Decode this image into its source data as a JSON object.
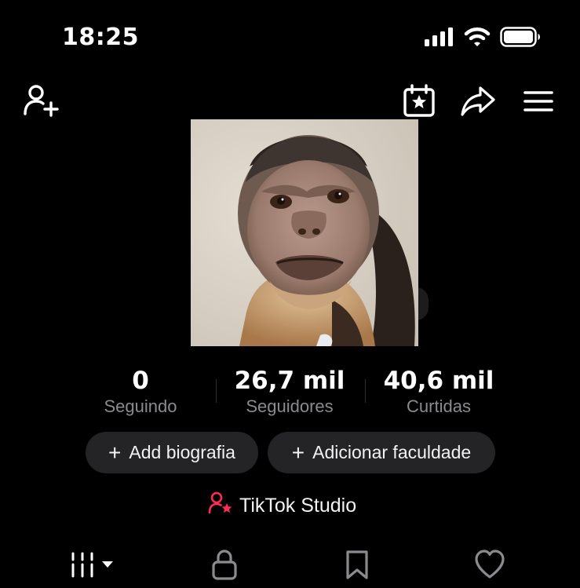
{
  "status_bar": {
    "time": "18:25",
    "icons": [
      "signal-icon",
      "wifi-icon",
      "battery-icon"
    ]
  },
  "header": {
    "left_icons": [
      "add-friend-icon"
    ],
    "right_icons": [
      "calendar-star-icon",
      "share-icon",
      "menu-icon"
    ]
  },
  "profile": {
    "avatar": "capuchin-monkey-photo"
  },
  "stats": [
    {
      "value": "0",
      "label": "Seguindo"
    },
    {
      "value": "26,7 mil",
      "label": "Seguidores"
    },
    {
      "value": "40,6 mil",
      "label": "Curtidas"
    }
  ],
  "actions": {
    "add_bio_label": "Add biografia",
    "add_college_label": "Adicionar faculdade",
    "plus_symbol": "+"
  },
  "studio": {
    "label": "TikTok Studio",
    "accent_color": "#fe2c55"
  },
  "tabs": [
    "grid-icon",
    "lock-icon",
    "bookmark-icon",
    "heart-icon"
  ],
  "colors": {
    "background": "#000000",
    "secondary_text": "#8a8a8f",
    "pill_background": "#242426"
  }
}
